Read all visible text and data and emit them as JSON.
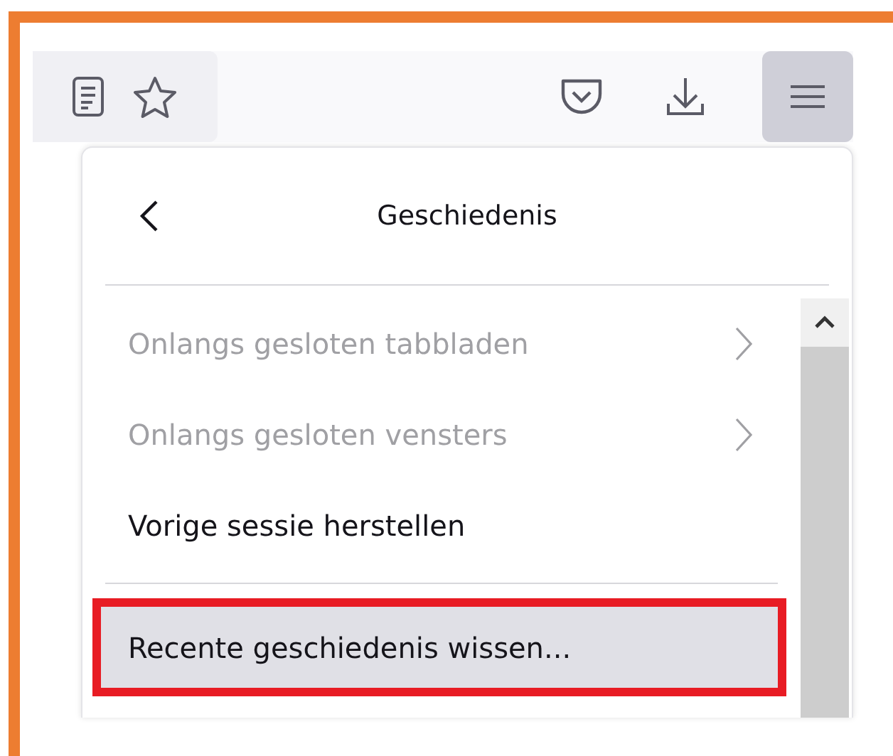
{
  "toolbar": {
    "menu_button": {
      "pressed": true
    }
  },
  "panel": {
    "title": "Geschiedenis",
    "items": [
      {
        "label": "Onlangs gesloten tabbladen",
        "disabled": true,
        "submenu": true,
        "separator_before": false,
        "highlighted": false
      },
      {
        "label": "Onlangs gesloten vensters",
        "disabled": true,
        "submenu": true,
        "separator_before": false,
        "highlighted": false
      },
      {
        "label": "Vorige sessie herstellen",
        "disabled": false,
        "submenu": false,
        "separator_before": false,
        "highlighted": false
      },
      {
        "label": "Recente geschiedenis wissen...",
        "disabled": false,
        "submenu": false,
        "separator_before": true,
        "highlighted": true
      }
    ]
  }
}
